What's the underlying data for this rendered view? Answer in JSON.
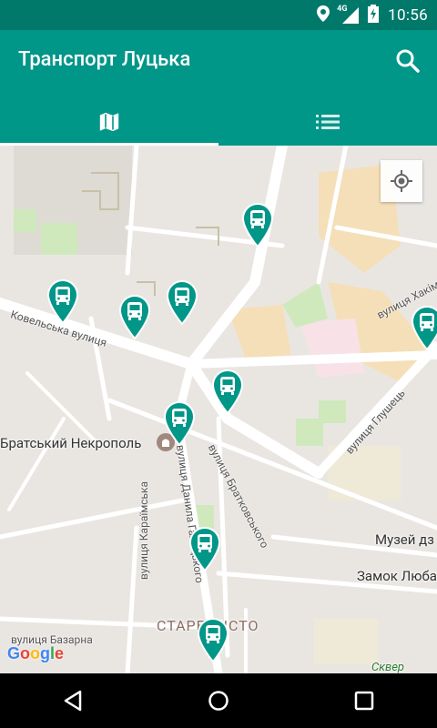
{
  "status_bar": {
    "network": "4G",
    "time": "10:56"
  },
  "app_bar": {
    "title": "Транспорт Луцька"
  },
  "tabs": [
    {
      "name": "map",
      "icon": "map-icon",
      "selected": true
    },
    {
      "name": "list",
      "icon": "list-icon",
      "selected": false
    }
  ],
  "map": {
    "places": {
      "necropolis": "Братський Некрополь",
      "museum": "Музей дз",
      "castle": "Замок Любa",
      "old_town": "СТАРЕ МІСТО",
      "square": "Сквер"
    },
    "streets": {
      "kovelska": "Ковельська вулиця",
      "hakim": "вулиця Хакім",
      "glushets": "вулиця Глушець",
      "bratkovskoho": "вулиця Братковського",
      "danyla": "вулиця Данила Галицького",
      "karaimska": "вулиця Караїмська",
      "bazarna": "вулиця Базарна"
    },
    "bus_stop_count": 10,
    "attribution": "Google"
  },
  "colors": {
    "primary": "#009688",
    "primary_dark": "#00796B"
  }
}
